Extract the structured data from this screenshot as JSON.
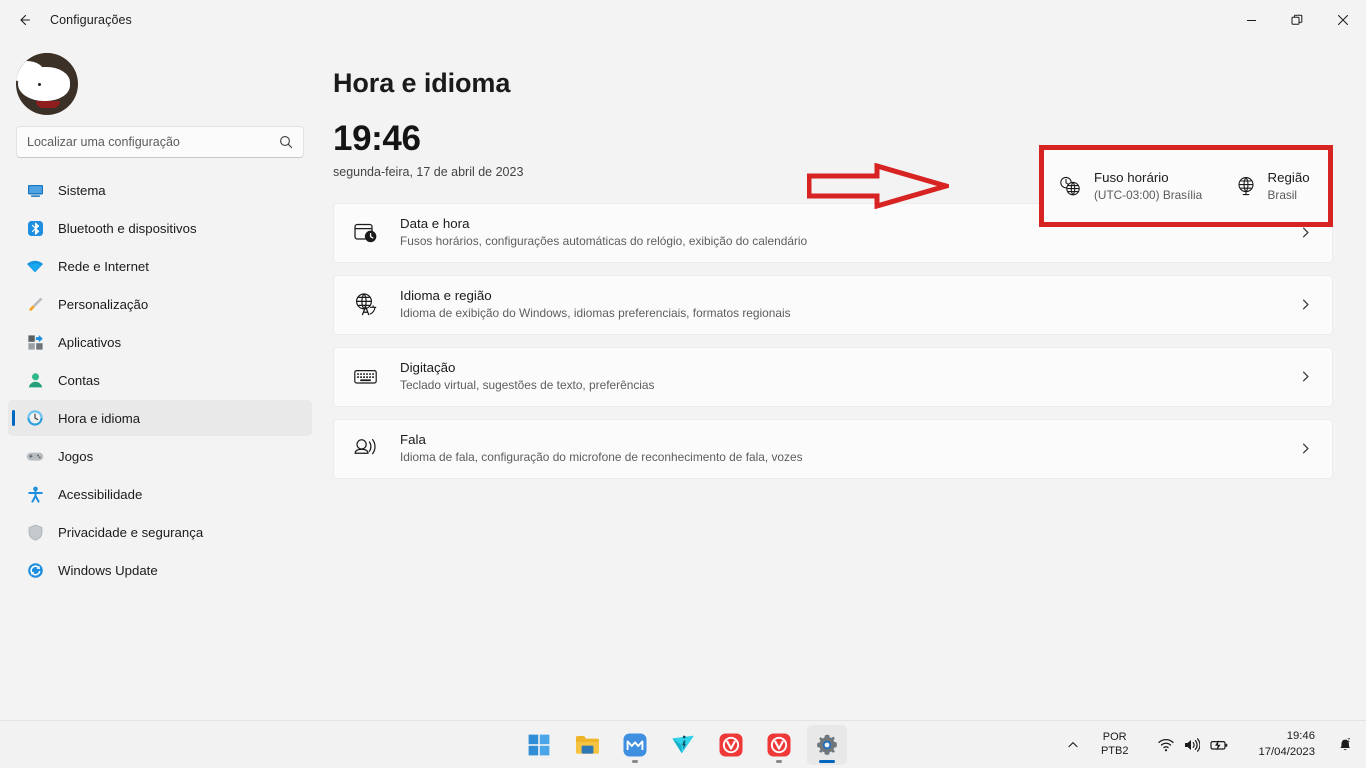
{
  "window": {
    "title": "Configurações",
    "back_icon": "back-arrow-icon",
    "minimize_label": "Minimizar",
    "maximize_label": "Restaurar",
    "close_label": "Fechar"
  },
  "sidebar": {
    "profile": {
      "name_redacted": "",
      "avatar_icon": "user-avatar"
    },
    "search": {
      "placeholder": "Localizar uma configuração",
      "value": "",
      "icon": "search-icon"
    },
    "items": [
      {
        "label": "Sistema",
        "icon": "system-icon",
        "active": false
      },
      {
        "label": "Bluetooth e dispositivos",
        "icon": "bluetooth-icon",
        "active": false
      },
      {
        "label": "Rede e Internet",
        "icon": "wifi-icon",
        "active": false
      },
      {
        "label": "Personalização",
        "icon": "paintbrush-icon",
        "active": false
      },
      {
        "label": "Aplicativos",
        "icon": "apps-icon",
        "active": false
      },
      {
        "label": "Contas",
        "icon": "accounts-icon",
        "active": false
      },
      {
        "label": "Hora e idioma",
        "icon": "clock-globe-icon",
        "active": true
      },
      {
        "label": "Jogos",
        "icon": "gamepad-icon",
        "active": false
      },
      {
        "label": "Acessibilidade",
        "icon": "accessibility-icon",
        "active": false
      },
      {
        "label": "Privacidade e segurança",
        "icon": "shield-icon",
        "active": false
      },
      {
        "label": "Windows Update",
        "icon": "update-icon",
        "active": false
      }
    ]
  },
  "main": {
    "page_title": "Hora e idioma",
    "clock": {
      "time": "19:46",
      "date": "segunda-feira, 17 de abril de 2023"
    },
    "annotation": {
      "arrow_icon": "red-arrow-right-icon",
      "highlight_color": "#d82323"
    },
    "info_cards": [
      {
        "title": "Fuso horário",
        "value": "(UTC-03:00) Brasília",
        "icon": "timezone-clock-globe-icon"
      },
      {
        "title": "Região",
        "value": "Brasil",
        "icon": "globe-icon"
      }
    ],
    "rows": [
      {
        "title": "Data e hora",
        "subtitle": "Fusos horários, configurações automáticas do relógio, exibição do calendário",
        "icon": "calendar-clock-icon",
        "chevron": "chevron-right-icon"
      },
      {
        "title": "Idioma e região",
        "subtitle": "Idioma de exibição do Windows, idiomas preferenciais, formatos regionais",
        "icon": "language-globe-icon",
        "chevron": "chevron-right-icon"
      },
      {
        "title": "Digitação",
        "subtitle": "Teclado virtual, sugestões de texto, preferências",
        "icon": "keyboard-icon",
        "chevron": "chevron-right-icon"
      },
      {
        "title": "Fala",
        "subtitle": "Idioma de fala, configuração do microfone de reconhecimento de fala, vozes",
        "icon": "speech-icon",
        "chevron": "chevron-right-icon"
      }
    ]
  },
  "taskbar": {
    "apps": [
      {
        "name": "start-button",
        "label": "Iniciar",
        "running": false,
        "active": false
      },
      {
        "name": "file-explorer",
        "label": "Explorador de Arquivos",
        "running": false,
        "active": false
      },
      {
        "name": "mega-app",
        "label": "MEGA",
        "running": true,
        "active": false
      },
      {
        "name": "teal-app",
        "label": "Aplicativo",
        "running": false,
        "active": false
      },
      {
        "name": "vivaldi-1",
        "label": "Vivaldi",
        "running": false,
        "active": false
      },
      {
        "name": "vivaldi-2",
        "label": "Vivaldi",
        "running": true,
        "active": false
      },
      {
        "name": "settings-app",
        "label": "Configurações",
        "running": true,
        "active": true
      }
    ],
    "tray": {
      "overflow_icon": "chevron-up-icon",
      "language_line1": "POR",
      "language_line2": "PTB2",
      "wifi_icon": "wifi-icon",
      "volume_icon": "speaker-icon",
      "battery_icon": "battery-charging-icon",
      "time": "19:46",
      "date": "17/04/2023",
      "notification_icon": "bell-dnd-icon"
    }
  },
  "colors": {
    "accent": "#0067c0",
    "annotation_red": "#d82323",
    "background": "#f3f3f3",
    "card": "#fbfbfb"
  }
}
